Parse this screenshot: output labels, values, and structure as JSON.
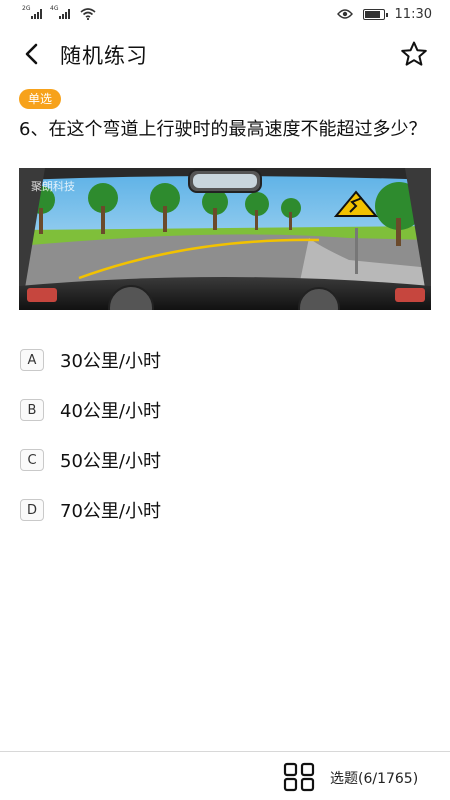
{
  "status_bar": {
    "sim1_tag": "2G",
    "sim2_tag": "4G",
    "time": "11:30",
    "battery_level": 0.85,
    "icons": [
      "signal-icon",
      "signal-icon",
      "wifi-icon",
      "eye-icon",
      "battery-icon"
    ]
  },
  "header": {
    "title": "随机练习",
    "back_icon": "chevron-left-icon",
    "favorite_icon": "star-outline-icon"
  },
  "question": {
    "type_badge": "单选",
    "text": "6、在这个弯道上行驶时的最高速度不能超过多少？",
    "image_watermark": "聚朗科技"
  },
  "options": [
    {
      "letter": "A",
      "text": "30公里/小时"
    },
    {
      "letter": "B",
      "text": "40公里/小时"
    },
    {
      "letter": "C",
      "text": "50公里/小时"
    },
    {
      "letter": "D",
      "text": "70公里/小时"
    }
  ],
  "bottom_bar": {
    "grid_icon": "grid-icon",
    "progress_label": "选题(6/1765)"
  },
  "colors": {
    "badge": "#f7a21b",
    "divider": "#d8d8d8",
    "text": "#111111"
  }
}
